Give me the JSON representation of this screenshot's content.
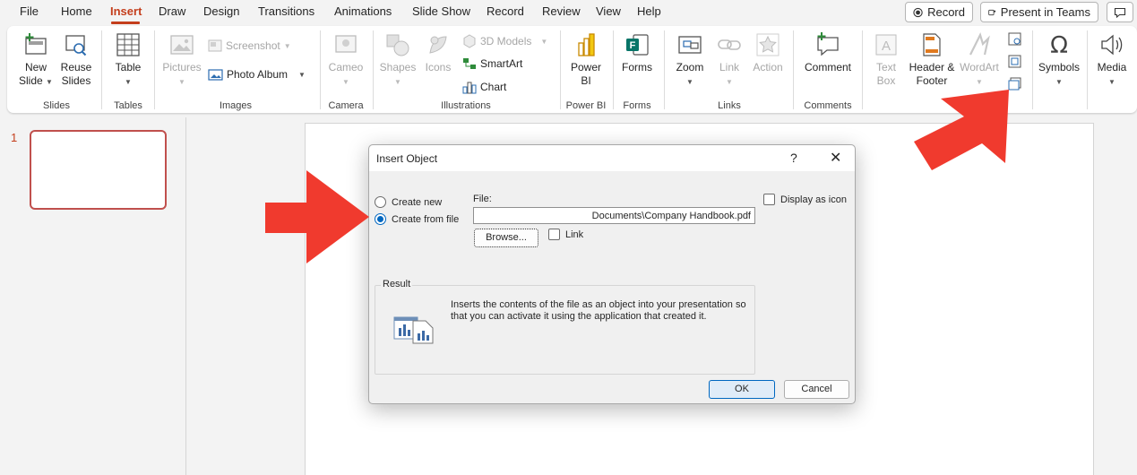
{
  "menu": {
    "tabs": [
      "File",
      "Home",
      "Insert",
      "Draw",
      "Design",
      "Transitions",
      "Animations",
      "Slide Show",
      "Record",
      "Review",
      "View",
      "Help"
    ],
    "active_tab": "Insert",
    "record_button": "Record",
    "present_button": "Present in Teams"
  },
  "ribbon": {
    "new_slide": "New Slide",
    "reuse_slides": "Reuse Slides",
    "slides_group": "Slides",
    "table": "Table",
    "tables_group": "Tables",
    "pictures": "Pictures",
    "screenshot": "Screenshot",
    "photo_album": "Photo Album",
    "images_group": "Images",
    "cameo": "Cameo",
    "camera_group": "Camera",
    "shapes": "Shapes",
    "icons": "Icons",
    "models_3d": "3D Models",
    "smartart": "SmartArt",
    "chart": "Chart",
    "illustrations_group": "Illustrations",
    "power_bi": "Power BI",
    "power_bi_group": "Power BI",
    "forms": "Forms",
    "forms_group": "Forms",
    "zoom": "Zoom",
    "link": "Link",
    "action": "Action",
    "links_group": "Links",
    "comment": "Comment",
    "comments_group": "Comments",
    "text_box": "Text Box",
    "header_footer": "Header & Footer",
    "wordart": "WordArt",
    "symbols": "Symbols",
    "media": "Media"
  },
  "slides_pane": {
    "slide_number": "1"
  },
  "dialog": {
    "title": "Insert Object",
    "help": "?",
    "close": "✕",
    "create_new": "Create new",
    "create_from_file": "Create from file",
    "selected_option": "Create from file",
    "file_label": "File:",
    "file_value": "Documents\\Company Handbook.pdf",
    "browse": "Browse...",
    "link": "Link",
    "display_as_icon": "Display as icon",
    "result_label": "Result",
    "result_text": "Inserts the contents of the file as an object into your presentation so that you can activate it using the application that created it.",
    "ok": "OK",
    "cancel": "Cancel"
  },
  "colors": {
    "accent": "#c43e1c",
    "annotation_arrow": "#f03a2e",
    "dialog_blue": "#0067c0"
  }
}
